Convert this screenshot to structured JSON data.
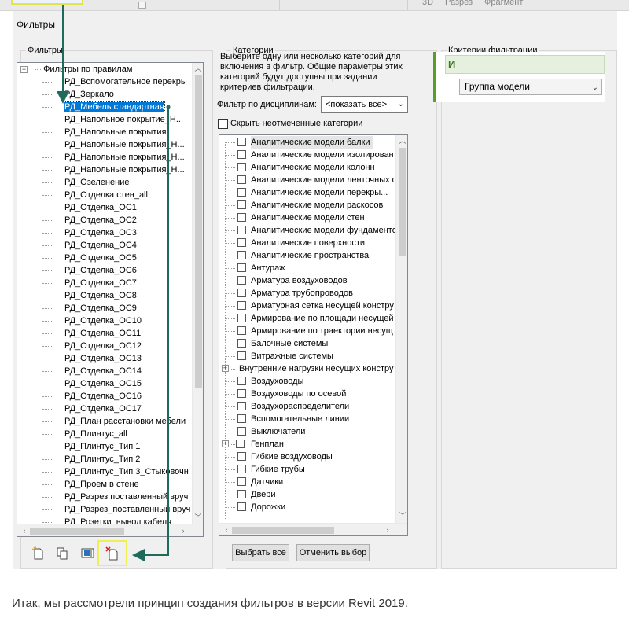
{
  "top_strip": {
    "items": [
      "3D",
      "Разрез",
      "Фрагмент"
    ]
  },
  "dialog": {
    "title": "Фильтры",
    "filters_group_label": "Фильтры",
    "categories_group_label": "Категории",
    "criteria_group_label": "Критерии фильтрации"
  },
  "filters_tree": {
    "root_label": "Фильтры по правилам",
    "expander": "−",
    "items": [
      "РД_Вспомогательное перекры",
      "РД_Зеркало",
      "РД_Мебель стандартная",
      "РД_Напольное покрытие_Н...",
      "РД_Напольные покрытия",
      "РД_Напольные покрытия_Н...",
      "РД_Напольные покрытия_Н...",
      "РД_Напольные покрытия_Н...",
      "РД_Озеленение",
      "РД_Отделка стен_all",
      "РД_Отделка_ОС1",
      "РД_Отделка_ОС2",
      "РД_Отделка_ОС3",
      "РД_Отделка_ОС4",
      "РД_Отделка_ОС5",
      "РД_Отделка_ОС6",
      "РД_Отделка_ОС7",
      "РД_Отделка_ОС8",
      "РД_Отделка_ОС9",
      "РД_Отделка_ОС10",
      "РД_Отделка_ОС11",
      "РД_Отделка_ОС12",
      "РД_Отделка_ОС13",
      "РД_Отделка_ОС14",
      "РД_Отделка_ОС15",
      "РД_Отделка_ОС16",
      "РД_Отделка_ОС17",
      "РД_План расстановки мебели",
      "РД_Плинтус_all",
      "РД_Плинтус_Тип 1",
      "РД_Плинтус_Тип 2",
      "РД_Плинтус_Тип 3_Стыковочн",
      "РД_Проем в стене",
      "РД_Разрез поставленный вруч",
      "РД_Разрез_поставленный вруч",
      "РД_Розетки_вывод кабеля"
    ],
    "selected_index": 2
  },
  "categories": {
    "description": "Выберите одну или несколько категорий для включения в фильтр. Общие параметры этих категорий будут доступны при задании критериев фильтрации.",
    "discipline_label": "Фильтр по дисциплинам:",
    "discipline_value": "<показать все>",
    "hide_unchecked_label": "Скрыть неотмеченные категории",
    "items": [
      {
        "label": "Аналитические модели балки",
        "expandable": false
      },
      {
        "label": "Аналитические модели изолирован",
        "expandable": false
      },
      {
        "label": "Аналитические модели колонн",
        "expandable": false
      },
      {
        "label": "Аналитические модели ленточных ф",
        "expandable": false
      },
      {
        "label": "Аналитические модели перекры...",
        "expandable": false
      },
      {
        "label": "Аналитические модели раскосов",
        "expandable": false
      },
      {
        "label": "Аналитические модели стен",
        "expandable": false
      },
      {
        "label": "Аналитические модели фундаменто",
        "expandable": false
      },
      {
        "label": "Аналитические поверхности",
        "expandable": false
      },
      {
        "label": "Аналитические пространства",
        "expandable": false
      },
      {
        "label": "Антураж",
        "expandable": false
      },
      {
        "label": "Арматура воздуховодов",
        "expandable": false
      },
      {
        "label": "Арматура трубопроводов",
        "expandable": false
      },
      {
        "label": "Арматурная сетка несущей констру",
        "expandable": false
      },
      {
        "label": "Армирование по площади несущей",
        "expandable": false
      },
      {
        "label": "Армирование по траектории несущ",
        "expandable": false
      },
      {
        "label": "Балочные системы",
        "expandable": false
      },
      {
        "label": "Витражные системы",
        "expandable": false
      },
      {
        "label": "Внутренние нагрузки несущих констру",
        "expandable": true
      },
      {
        "label": "Воздуховоды",
        "expandable": false
      },
      {
        "label": "Воздуховоды по осевой",
        "expandable": false
      },
      {
        "label": "Воздухораспределители",
        "expandable": false
      },
      {
        "label": "Вспомогательные линии",
        "expandable": false
      },
      {
        "label": "Выключатели",
        "expandable": false
      },
      {
        "label": "Генплан",
        "expandable": true
      },
      {
        "label": "Гибкие воздуховоды",
        "expandable": false
      },
      {
        "label": "Гибкие трубы",
        "expandable": false
      },
      {
        "label": "Датчики",
        "expandable": false
      },
      {
        "label": "Двери",
        "expandable": false
      },
      {
        "label": "Дорожки",
        "expandable": false
      }
    ],
    "select_all_label": "Выбрать все",
    "deselect_label": "Отменить выбор"
  },
  "criteria": {
    "and_label": "И",
    "parameter_value": "Группа модели"
  },
  "toolbar": {
    "icons": [
      "new-filter-icon",
      "duplicate-filter-icon",
      "rename-filter-icon",
      "delete-filter-icon"
    ]
  },
  "caption": "Итак, мы рассмотрели принцип создания фильтров в версии Revit 2019.",
  "colors": {
    "selection": "#0078d7",
    "arrow": "#1e6b5e",
    "highlight": "#eeee55",
    "criteria_green": "#5a9e2a"
  }
}
